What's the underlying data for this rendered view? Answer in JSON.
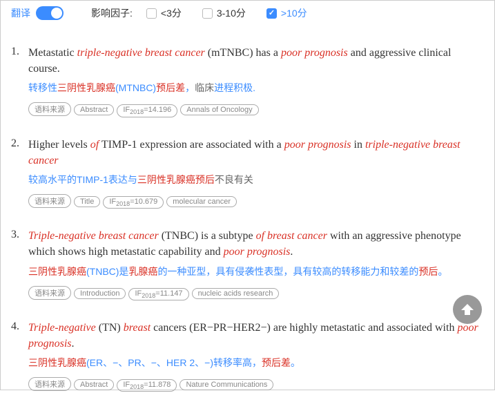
{
  "topbar": {
    "translate_label": "翻译",
    "filter_label": "影响因子:",
    "filters": [
      {
        "label": "<3分",
        "checked": false
      },
      {
        "label": "3-10分",
        "checked": false
      },
      {
        "label": ">10分",
        "checked": true
      }
    ]
  },
  "tags_common": {
    "source": "语料来源",
    "if_prefix": "IF",
    "if_year": "2018"
  },
  "results": [
    {
      "num": "1.",
      "en": "Metastatic |triple-negative breast cancer| (mTNBC) has a |poor prognosis| and aggressive clinical course.",
      "zh_html": "转移性<span class='red'>三阴性乳腺癌</span>(MTNBC)<span class='red'>预后差</span>，<span class='plain'>临床</span>进程积极.",
      "section": "Abstract",
      "if": "=14.196",
      "journal": "Annals of Oncology"
    },
    {
      "num": "2.",
      "en": "Higher levels |of| TIMP-1 expression are associated with a |poor prognosis| in |triple-negative breast cancer|",
      "zh_html": "较高水平的TIMP-1表达与<span class='red'>三阴性乳腺癌预后</span><span class='plain'>不良有关</span>",
      "section": "Title",
      "if": "=10.679",
      "journal": "molecular cancer"
    },
    {
      "num": "3.",
      "en": "|Triple-negative breast cancer| (TNBC) is a subtype |of breast cancer| with an aggressive phenotype which shows high metastatic capability and |poor prognosis|.",
      "zh_html": "<span class='red'>三阴性乳腺癌</span>(TNBC)是<span class='red'>乳腺癌</span>的一种亚型，具有侵袭性表型，具有较高的转移能力和较差的<span class='red'>预后</span>。",
      "section": "Introduction",
      "if": "=11.147",
      "journal": "nucleic acids research"
    },
    {
      "num": "4.",
      "en": "|Triple-negative| (TN) |breast| cancers (ER−PR−HER2−) are highly metastatic and associated with |poor prognosis|.",
      "zh_html": "<span class='red'>三阴性乳腺癌</span>(ER、−、PR、−、HER 2、−)转移率高，<span class='red'>预后差</span>。",
      "section": "Abstract",
      "if": "=11.878",
      "journal": "Nature Communications"
    }
  ]
}
